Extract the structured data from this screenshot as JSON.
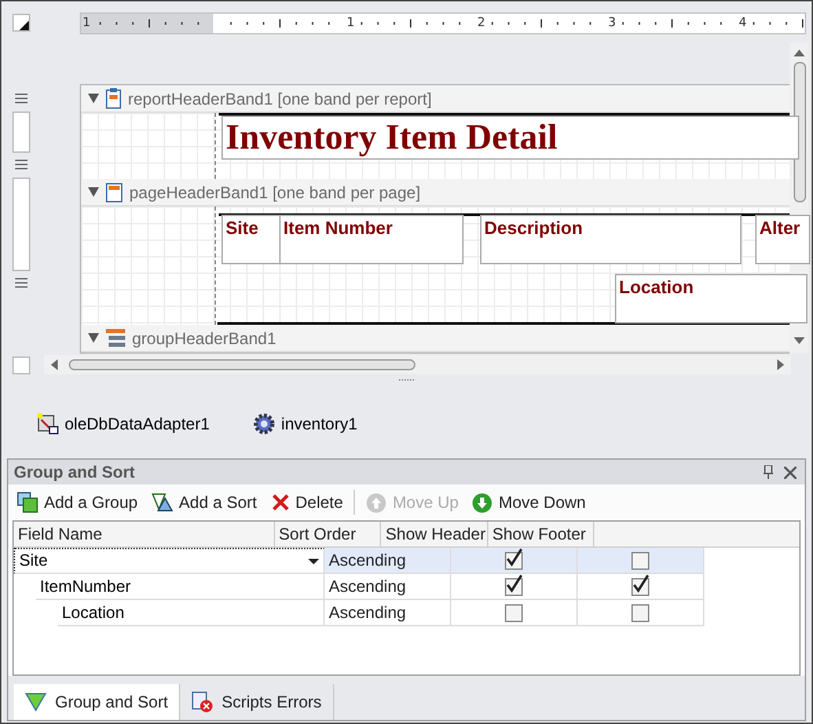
{
  "ruler": {
    "labels": [
      "1",
      "1",
      "2",
      "3",
      "4"
    ]
  },
  "bands": [
    {
      "kind": "report",
      "title": "reportHeaderBand1",
      "note": "[one band per report]",
      "fields": [
        {
          "kind": "title",
          "text": "Inventory Item Detail"
        }
      ]
    },
    {
      "kind": "page",
      "title": "pageHeaderBand1",
      "note": "[one band per page]",
      "fields": [
        {
          "kind": "label",
          "text": "Site"
        },
        {
          "kind": "label",
          "text": "Item Number"
        },
        {
          "kind": "label",
          "text": "Description"
        },
        {
          "kind": "label",
          "text": "Alter"
        },
        {
          "kind": "label",
          "text": "Location"
        }
      ]
    },
    {
      "kind": "group",
      "title": "groupHeaderBand1"
    }
  ],
  "tray": [
    {
      "kind": "adapter",
      "label": "oleDbDataAdapter1"
    },
    {
      "kind": "dataset",
      "label": "inventory1"
    }
  ],
  "panel": {
    "title": "Group and Sort",
    "toolbar": [
      {
        "kind": "add_group",
        "label": "Add a Group",
        "disabled": false
      },
      {
        "kind": "add_sort",
        "label": "Add a Sort",
        "disabled": false
      },
      {
        "kind": "delete",
        "label": "Delete",
        "disabled": false
      },
      {
        "kind": "move_up",
        "label": "Move Up",
        "disabled": true
      },
      {
        "kind": "move_down",
        "label": "Move Down",
        "disabled": false
      }
    ],
    "columns": [
      "Field Name",
      "Sort Order",
      "Show Header",
      "Show Footer"
    ],
    "rows": [
      {
        "field": "Site",
        "sort": "Ascending",
        "show_header": true,
        "show_footer": false,
        "selected": true,
        "children": [
          {
            "field": "ItemNumber",
            "sort": "Ascending",
            "show_header": true,
            "show_footer": true,
            "selected": false,
            "children": [
              {
                "field": "Location",
                "sort": "Ascending",
                "show_header": false,
                "show_footer": false,
                "selected": false
              }
            ]
          }
        ]
      }
    ],
    "tabs": [
      {
        "kind": "group_sort",
        "label": "Group and Sort",
        "selected": true
      },
      {
        "kind": "scripts",
        "label": "Scripts Errors",
        "selected": false
      }
    ]
  }
}
